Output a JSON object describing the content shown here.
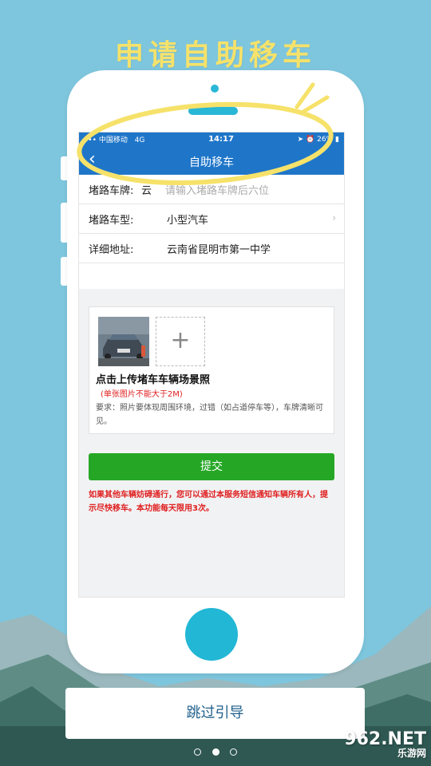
{
  "headline": "申请自助移车",
  "colors": {
    "accent_blue": "#1f76c9",
    "submit_green": "#25a725",
    "warning_red": "#e02020",
    "highlight_yellow": "#f6e26a"
  },
  "status_bar": {
    "carrier": "中国移动",
    "network": "4G",
    "time": "14:17",
    "battery": "26%"
  },
  "nav": {
    "back_icon": "chevron-left-icon",
    "title": "自助移车"
  },
  "form": {
    "plate_label": "堵路车牌:",
    "plate_prefix": "云",
    "plate_placeholder": "请输入堵路车牌后六位",
    "type_label": "堵路车型:",
    "type_value": "小型汽车",
    "address_label": "详细地址:",
    "address_value": "云南省昆明市第一中学"
  },
  "upload": {
    "title": "点击上传堵车车辆场景照",
    "size_warning": "(单张图片不能大于2M)",
    "requirement": "要求：照片要体现周围环境，过错（如占道停车等），车牌清晰可见。",
    "plus": "+"
  },
  "submit_label": "提交",
  "notice": "如果其他车辆妨碍通行，您可以通过本服务短信通知车辆所有人，提示尽快移车。本功能每天限用3次。",
  "skip_label": "跳过引导",
  "pager": {
    "total": 3,
    "active": 2
  },
  "watermark": {
    "main": "962.NET",
    "sub": "乐游网"
  }
}
